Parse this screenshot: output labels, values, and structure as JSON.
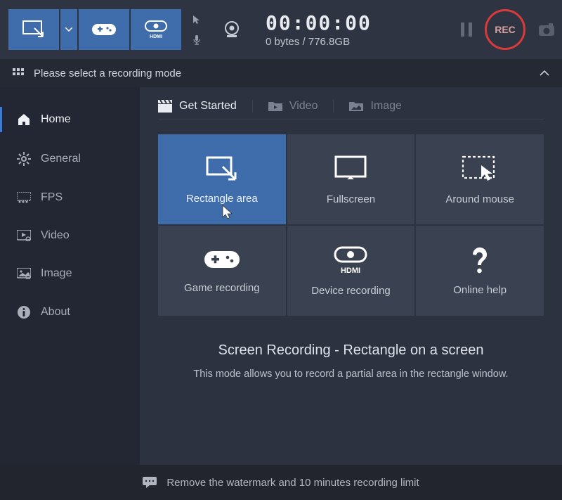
{
  "toolbar": {
    "timer": "00:00:00",
    "size": "0 bytes / 776.8GB",
    "rec_label": "REC"
  },
  "banner": {
    "text": "Please select a recording mode"
  },
  "sidebar": {
    "items": [
      {
        "label": "Home"
      },
      {
        "label": "General"
      },
      {
        "label": "FPS"
      },
      {
        "label": "Video"
      },
      {
        "label": "Image"
      },
      {
        "label": "About"
      }
    ]
  },
  "tabs": [
    {
      "label": "Get Started"
    },
    {
      "label": "Video"
    },
    {
      "label": "Image"
    }
  ],
  "tiles": [
    {
      "label": "Rectangle area"
    },
    {
      "label": "Fullscreen"
    },
    {
      "label": "Around mouse"
    },
    {
      "label": "Game recording"
    },
    {
      "label": "Device recording"
    },
    {
      "label": "Online help"
    }
  ],
  "description": {
    "title": "Screen Recording - Rectangle on a screen",
    "body": "This mode allows you to record a partial area in the rectangle window."
  },
  "footer": {
    "text": "Remove the watermark and 10 minutes recording limit"
  }
}
